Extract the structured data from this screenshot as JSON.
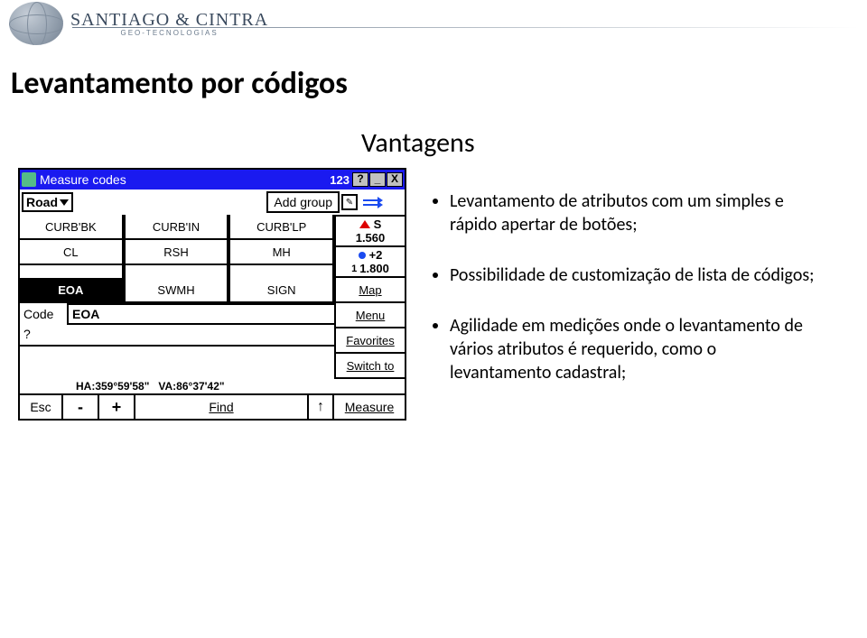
{
  "brand": {
    "name": "SANTIAGO & CINTRA",
    "sub": "GEO-TECNOLOGIAS"
  },
  "page_title": "Levantamento por códigos",
  "subtitle": "Vantagens",
  "bullets": [
    "Levantamento de atributos com um simples e rápido apertar de botões;",
    "Possibilidade de customização de lista de códigos;",
    "Agilidade em medições onde o levantamento de vários atributos é requerido, como o levantamento cadastral;"
  ],
  "win": {
    "title": "Measure codes",
    "ime": "123",
    "help": "?",
    "road": "Road",
    "add_group": "Add group",
    "codes": [
      [
        "CURB'BK",
        "CURB'IN",
        "CURB'LP"
      ],
      [
        "CL",
        "RSH",
        "MH"
      ],
      [
        "EOA",
        "SWMH",
        "SIGN"
      ]
    ],
    "selected_code": "EOA",
    "side_map": "Map",
    "side_menu": "Menu",
    "side_fav": "Favorites",
    "side_switch": "Switch to",
    "code_label": "Code",
    "code_value": "EOA",
    "q": "?",
    "status_ha": "HA:359°59'58\"",
    "status_va": "VA:86°37'42\"",
    "esc": "Esc",
    "minus": "-",
    "plus": "+",
    "find": "Find",
    "arrow": "↑",
    "measure": "Measure",
    "staff_s": "S",
    "staff_v1": "1.560",
    "staff_plus": "+2",
    "staff_v2": "1.800"
  }
}
